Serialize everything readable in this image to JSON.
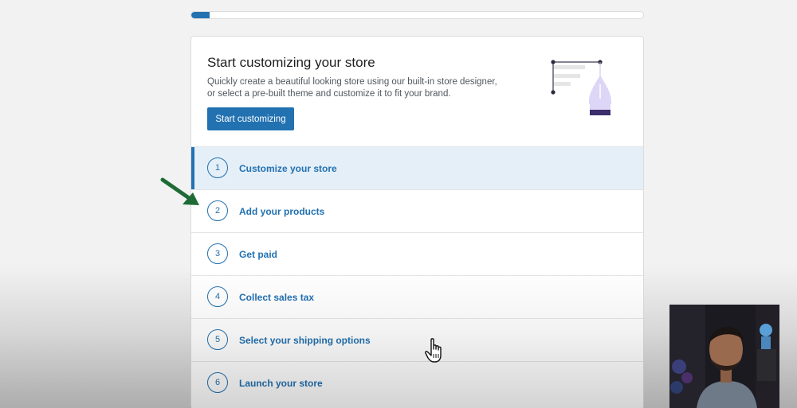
{
  "progress": {
    "value_percent": 4
  },
  "header": {
    "title": "Start customizing your store",
    "description": "Quickly create a beautiful looking store using our built-in store designer, or select a pre-built theme and customize it to fit your brand.",
    "button_label": "Start customizing"
  },
  "steps": [
    {
      "number": "1",
      "label": "Customize your store",
      "active": true
    },
    {
      "number": "2",
      "label": "Add your products",
      "active": false
    },
    {
      "number": "3",
      "label": "Get paid",
      "active": false
    },
    {
      "number": "4",
      "label": "Collect sales tax",
      "active": false
    },
    {
      "number": "5",
      "label": "Select your shipping options",
      "active": false
    },
    {
      "number": "6",
      "label": "Launch your store",
      "active": false
    }
  ],
  "colors": {
    "accent": "#2271b1",
    "active_bg": "#e5eff8",
    "arrow": "#1e6b35"
  },
  "icons": [
    "design-pen-illustration",
    "green-arrow-icon",
    "hand-cursor-icon"
  ]
}
